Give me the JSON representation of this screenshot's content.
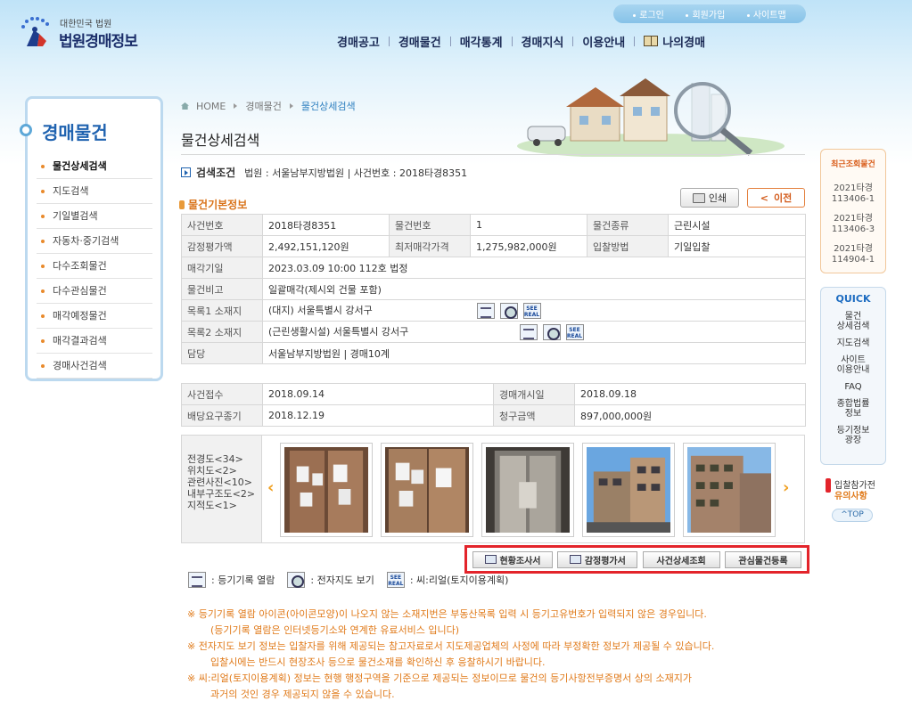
{
  "header": {
    "logo_small": "대한민국 법원",
    "logo_big": "법원경매정보",
    "util_links": [
      "로그인",
      "회원가입",
      "사이트맵"
    ],
    "gnb": [
      "경매공고",
      "경매물건",
      "매각통계",
      "경매지식",
      "이용안내",
      "나의경매"
    ]
  },
  "sidebar": {
    "title": "경매물건",
    "items": [
      "물건상세검색",
      "지도검색",
      "기일별검색",
      "자동차·중기검색",
      "다수조회물건",
      "다수관심물건",
      "매각예정물건",
      "매각결과검색",
      "경매사건검색"
    ]
  },
  "breadcrumb": {
    "home": "HOME",
    "level1": "경매물건",
    "current": "물건상세검색"
  },
  "page_title": "물건상세검색",
  "search_condition": {
    "label": "검색조건",
    "text": "법원 : 서울남부지방법원 | 사건번호 : 2018타경8351"
  },
  "section_title": "물건기본정보",
  "buttons": {
    "print": "인쇄",
    "prev": "이전"
  },
  "basic_info": {
    "case_no_label": "사건번호",
    "case_no": "2018타경8351",
    "item_no_label": "물건번호",
    "item_no": "1",
    "item_type_label": "물건종류",
    "item_type": "근린시설",
    "appraisal_label": "감정평가액",
    "appraisal": "2,492,151,120원",
    "min_price_label": "최저매각가격",
    "min_price": "1,275,982,000원",
    "bid_method_label": "입찰방법",
    "bid_method": "기일입찰",
    "sale_date_label": "매각기일",
    "sale_date": "2023.03.09 10:00 112호 법정",
    "note_label": "물건비고",
    "note": "일괄매각(제시외 건물 포함)",
    "loc1_label": "목록1 소재지",
    "loc1": "(대지) 서울특별시 강서구",
    "loc2_label": "목록2 소재지",
    "loc2": "(근린생활시설) 서울특별시 강서구",
    "dept_label": "담당",
    "dept": "서울남부지방법원 | 경매10계"
  },
  "case_info": {
    "received_label": "사건접수",
    "received": "2018.09.14",
    "start_label": "경매개시일",
    "start": "2018.09.18",
    "deadline_label": "배당요구종기",
    "deadline": "2018.12.19",
    "claim_label": "청구금액",
    "claim": "897,000,000원"
  },
  "photo_labels": [
    "전경도<34>",
    "위치도<2>",
    "관련사진<10>",
    "내부구조도<2>",
    "지적도<1>"
  ],
  "actions": [
    "현황조사서",
    "감정평가서",
    "사건상세조회",
    "관심물건등록"
  ],
  "legend": {
    "registry": "등기기록 열람",
    "map": "전자지도 보기",
    "seereal": "씨:리얼(토지이용계획)"
  },
  "notes": [
    "※ 등기기록 열람 아이콘(아이콘모양)이 나오지 않는 소재지번은 부동산목록 입력 시 등기고유번호가 입력되지 않은 경우입니다.",
    "(등기기록 열람은 인터넷등기소와 연계한 유료서비스 입니다)",
    "※ 전자지도 보기 정보는 입찰자를 위해 제공되는 참고자료로서 지도제공업체의 사정에 따라 부정확한 정보가 제공될 수 있습니다.",
    "입찰시에는 반드시 현장조사 등으로 물건소재를 확인하신 후 응찰하시기 바랍니다.",
    "※ 씨:리얼(토지이용계획) 정보는 현행 행정구역을 기준으로 제공되는 정보이므로 물건의 등기사항전부증명서 상의 소재지가",
    "과거의 것인 경우 제공되지 않을 수 있습니다."
  ],
  "recent": {
    "title": "최근조회물건",
    "items": [
      [
        "2021타경",
        "113406-1"
      ],
      [
        "2021타경",
        "113406-3"
      ],
      [
        "2021타경",
        "114904-1"
      ]
    ]
  },
  "quick": {
    "title": "QUICK",
    "items": [
      [
        "물건",
        "상세검색"
      ],
      [
        "지도검색"
      ],
      [
        "사이트",
        "이용안내"
      ],
      [
        "FAQ"
      ],
      [
        "종합법률",
        "정보"
      ],
      [
        "등기정보",
        "광장"
      ]
    ]
  },
  "warning": {
    "line1": "입찰참가전",
    "line2": "유의사항"
  },
  "top_label": "TOP",
  "colors": {
    "accent_blue": "#2063b0",
    "accent_orange": "#e07a1a",
    "highlight_red": "#e3242b"
  }
}
